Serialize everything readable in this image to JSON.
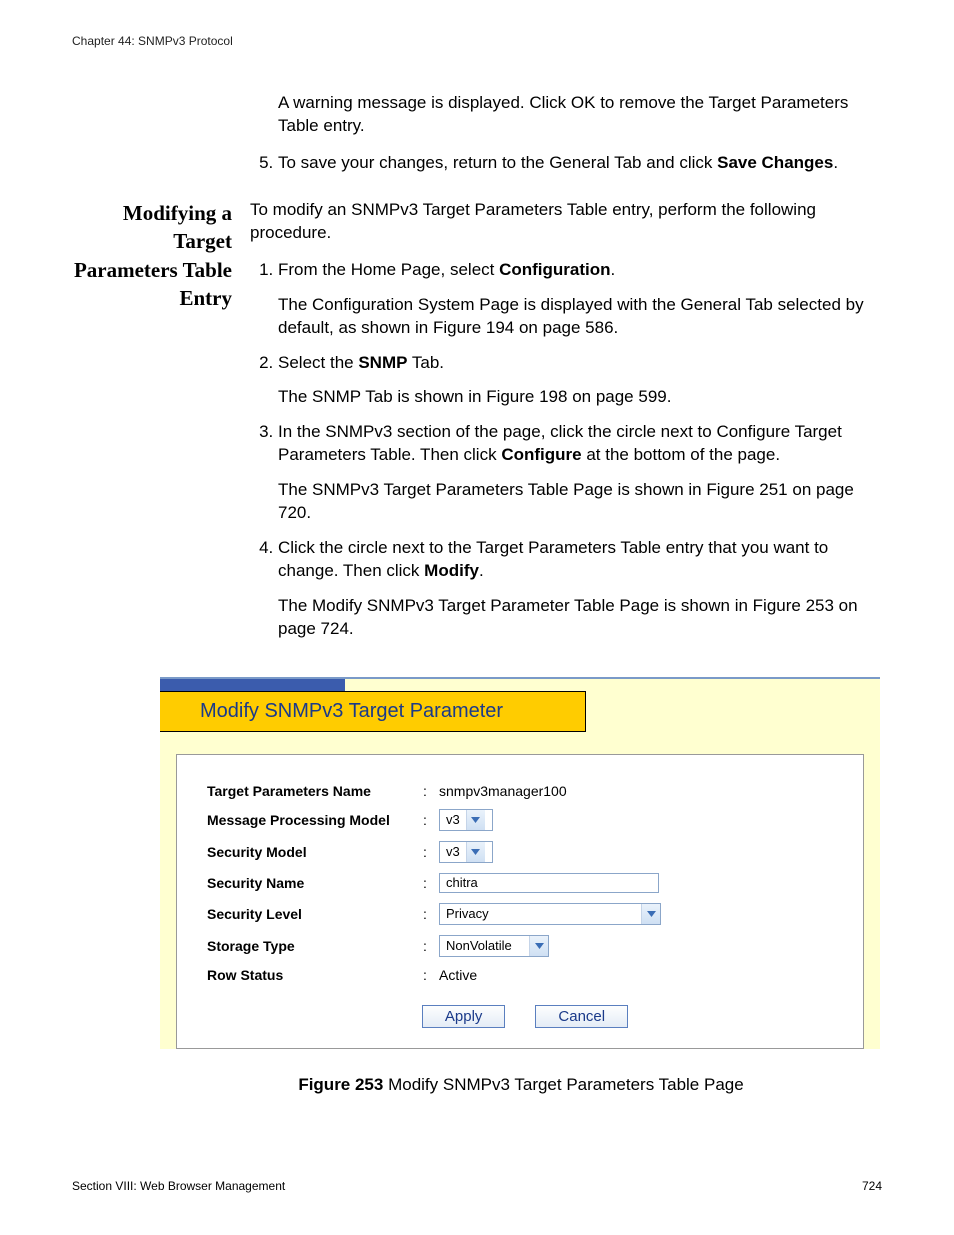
{
  "header": {
    "chapter": "Chapter 44: SNMPv3 Protocol"
  },
  "top": {
    "warning": "A warning message is displayed. Click OK to remove the Target Parameters Table entry.",
    "step5_a": "To save your changes, return to the General Tab and click ",
    "step5_b": "Save Changes",
    "step5_c": "."
  },
  "side_title": "Modifying a Target Parameters Table Entry",
  "intro": "To modify an SNMPv3 Target Parameters Table entry, perform the following procedure.",
  "steps": {
    "s1_a": "From the Home Page, select ",
    "s1_b": "Configuration",
    "s1_c": ".",
    "s1_sub": "The Configuration System Page is displayed with the General Tab selected by default, as shown in Figure 194 on page 586.",
    "s2_a": "Select the ",
    "s2_b": "SNMP",
    "s2_c": " Tab.",
    "s2_sub": "The SNMP Tab is shown in Figure 198 on page 599.",
    "s3_a": "In the SNMPv3 section of the page, click the circle next to Configure Target Parameters Table. Then click ",
    "s3_b": "Configure",
    "s3_c": " at the bottom of the page.",
    "s3_sub": "The SNMPv3 Target Parameters Table Page is shown in Figure 251 on page 720.",
    "s4_a": "Click the circle next to the Target Parameters Table entry that you want to change. Then click ",
    "s4_b": "Modify",
    "s4_c": ".",
    "s4_sub": "The Modify SNMPv3 Target Parameter Table Page is shown in Figure 253 on page 724."
  },
  "figure": {
    "panel_title": "Modify SNMPv3 Target Parameter",
    "labels": {
      "target_params_name": "Target Parameters Name",
      "mpm": "Message Processing Model",
      "sec_model": "Security Model",
      "sec_name": "Security Name",
      "sec_level": "Security Level",
      "storage": "Storage Type",
      "row_status": "Row Status"
    },
    "values": {
      "target_params_name": "snmpv3manager100",
      "mpm": "v3",
      "sec_model": "v3",
      "sec_name": "chitra",
      "sec_level": "Privacy",
      "storage": "NonVolatile",
      "row_status": "Active"
    },
    "buttons": {
      "apply": "Apply",
      "cancel": "Cancel"
    },
    "caption_b": "Figure 253",
    "caption_rest": "  Modify SNMPv3 Target Parameters Table Page"
  },
  "footer": {
    "section": "Section VIII: Web Browser Management",
    "page": "724"
  }
}
